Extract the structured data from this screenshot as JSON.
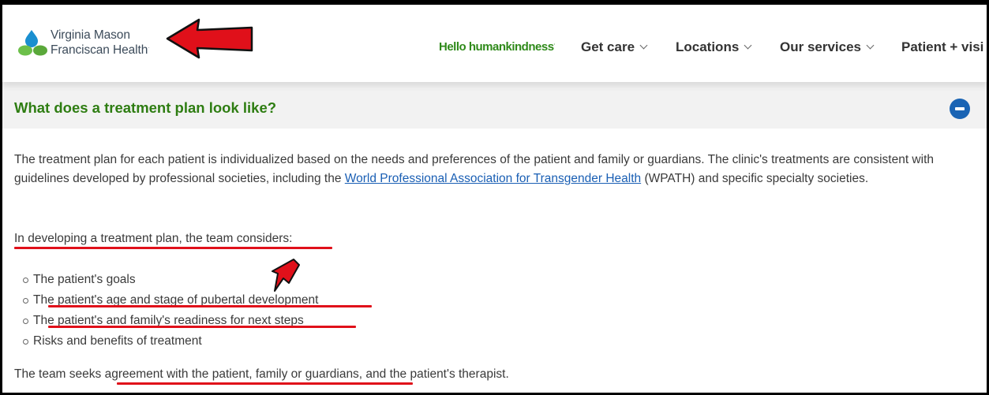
{
  "header": {
    "brand_line1": "Virginia Mason",
    "brand_line2": "Franciscan Health",
    "tagline": "Hello humankindness",
    "nav": [
      {
        "label": "Get care"
      },
      {
        "label": "Locations"
      },
      {
        "label": "Our services"
      },
      {
        "label": "Patient + visi"
      }
    ]
  },
  "section": {
    "title": "What does a treatment plan look like?",
    "para1_before": "The treatment plan for each patient is individualized based on the needs and preferences of the patient and family or guardians. The clinic's treatments are consistent with guidelines developed by professional societies, including the ",
    "para1_link": "World Professional Association for Transgender Health",
    "para1_after": " (WPATH) and specific specialty societies.",
    "intro": "In developing a treatment plan, the team considers:",
    "items": [
      "The patient's goals",
      "The patient's age and stage of pubertal development",
      "The patient's and family's readiness for next steps",
      "Risks and benefits of treatment"
    ],
    "closing_before": "The team seeks ",
    "closing_highlight": "agreement with the patient, family or guardians,",
    "closing_after": " and the patient's therapist."
  },
  "colors": {
    "accent_green": "#2e7d12",
    "link_blue": "#1a5fb4",
    "annotation_red": "#e0101a"
  }
}
